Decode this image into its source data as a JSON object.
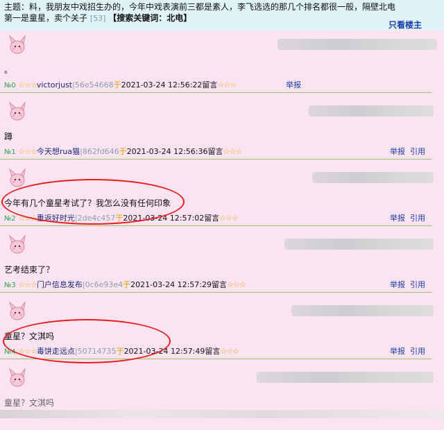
{
  "topic": {
    "line1": "主题：料，我朋友中戏招生办的，今年中戏表演前三都是素人，李飞选选的那几个排名都很一般，隔壁北电",
    "line2": "第一是童星，卖个关子",
    "count": "[53]",
    "keyword": "【搜索关键词：北电】",
    "only_op": "只看楼主"
  },
  "posts": [
    {
      "content": "。",
      "floor": "№0",
      "stars_a": "☆☆☆",
      "name": "victorjust",
      "hash": "|56e54668",
      "yu": "于",
      "time": "2021-03-24 12:56:22",
      "msg": "留言",
      "stars_b": "☆☆☆",
      "report": "举报",
      "quote": ""
    },
    {
      "content": "蹲",
      "floor": "№1",
      "stars_a": "☆☆☆",
      "name": "今天想rua猫",
      "hash": "|862fd646",
      "yu": "于",
      "time": "2021-03-24 12:56:36",
      "msg": "留言",
      "stars_b": "☆☆☆",
      "report": "举报",
      "quote": "引用"
    },
    {
      "content": "今年有几个童星考试了？我怎么没有任何印象",
      "floor": "№2",
      "stars_a": "☆☆☆",
      "name": "重返好时光",
      "hash": "|2de4c457",
      "yu": "于",
      "time": "2021-03-24 12:57:02",
      "msg": "留言",
      "stars_b": "☆☆☆",
      "report": "举报",
      "quote": "引用"
    },
    {
      "content": "艺考结束了？",
      "floor": "№3",
      "stars_a": "☆☆☆",
      "name": "门户信息发布",
      "hash": "|0c6e93e4",
      "yu": "于",
      "time": "2021-03-24 12:57:29",
      "msg": "留言",
      "stars_b": "☆☆☆",
      "report": "举报",
      "quote": "引用"
    },
    {
      "content": "童星？文淇吗",
      "floor": "№4",
      "stars_a": "☆☆☆",
      "name": "毒饼走远点",
      "hash": "|50714735",
      "yu": "于",
      "time": "2021-03-24 12:57:49",
      "msg": "留言",
      "stars_b": "☆☆☆",
      "report": "举报",
      "quote": "引用"
    },
    {
      "content": "童星？文淇吗",
      "floor": "",
      "stars_a": "",
      "name": "",
      "hash": "",
      "yu": "",
      "time": "",
      "msg": "",
      "stars_b": "",
      "report": "",
      "quote": ""
    }
  ],
  "colors": {
    "annotation": "#e81c1c",
    "link": "#1a3cb0",
    "floor": "#2aa348",
    "star": "#e0b200"
  }
}
